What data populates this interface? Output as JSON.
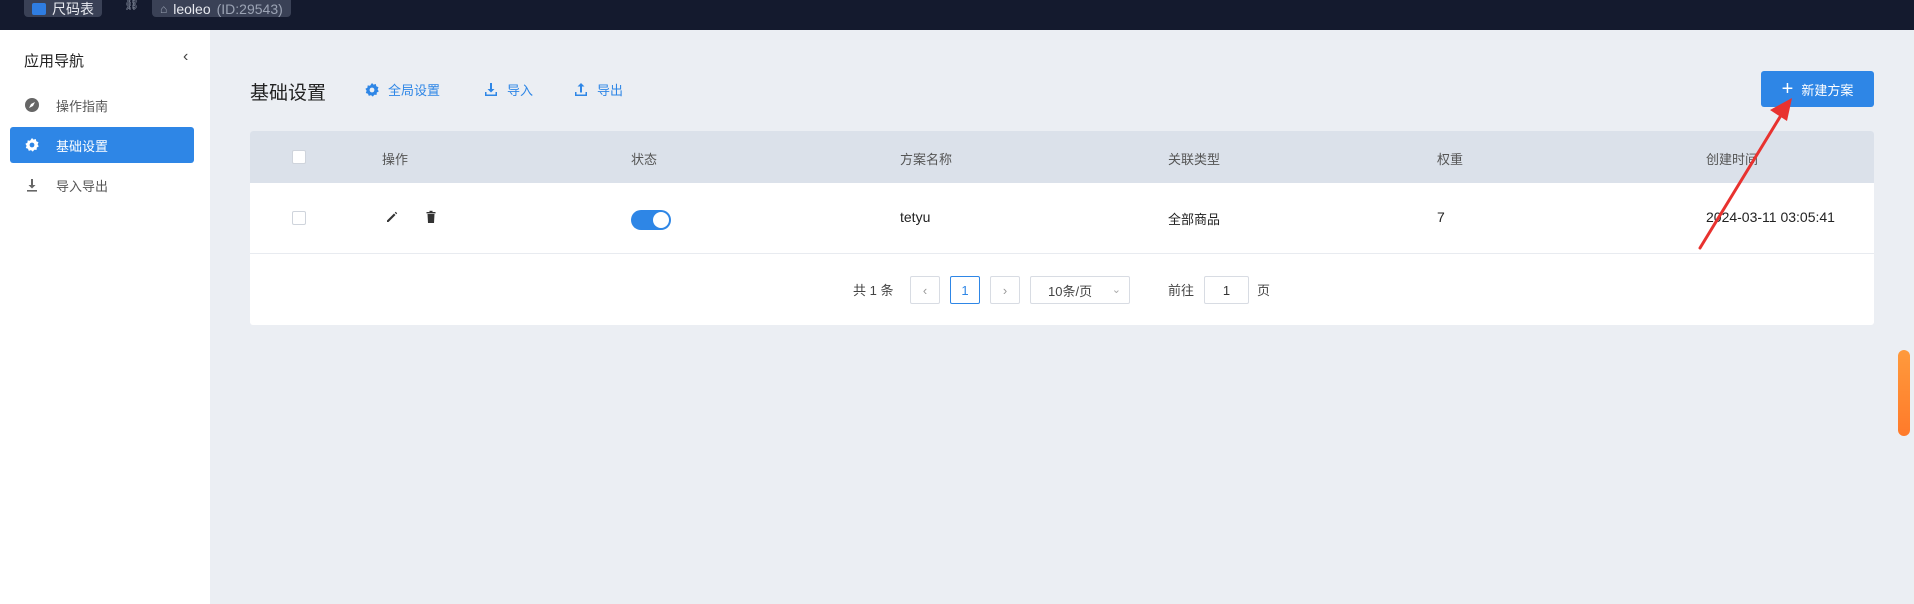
{
  "topbar": {
    "app_chip": "尺码表",
    "store_name": "leoleo",
    "store_id": "(ID:29543)"
  },
  "sidebar": {
    "title": "应用导航",
    "items": [
      {
        "label": "操作指南",
        "icon": "compass-icon"
      },
      {
        "label": "基础设置",
        "icon": "gear-icon",
        "active": true
      },
      {
        "label": "导入导出",
        "icon": "download-icon"
      }
    ]
  },
  "toolbar": {
    "page_title": "基础设置",
    "global_settings": "全局设置",
    "import": "导入",
    "export": "导出",
    "new_plan": "新建方案"
  },
  "table": {
    "columns": [
      "操作",
      "状态",
      "方案名称",
      "关联类型",
      "权重",
      "创建时间"
    ],
    "rows": [
      {
        "status_on": true,
        "name": "tetyu",
        "type": "全部商品",
        "weight": "7",
        "created": "2024-03-11 03:05:41"
      }
    ]
  },
  "pagination": {
    "total": "共 1 条",
    "current_page": "1",
    "page_size": "10条/页",
    "goto_label": "前往",
    "goto_value": "1",
    "page_suffix": "页"
  },
  "colors": {
    "accent": "#2e86e6",
    "topbar": "#141a2e",
    "annotation_arrow": "#e8322f"
  }
}
